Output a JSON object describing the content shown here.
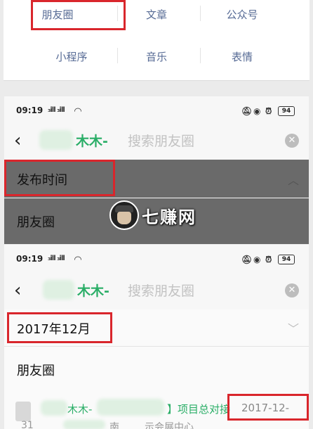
{
  "categories": {
    "row1": [
      "朋友圈",
      "文章",
      "公众号"
    ],
    "row2": [
      "小程序",
      "音乐",
      "表情"
    ]
  },
  "watermark": "七赚网",
  "screens": [
    {
      "time": "09:19",
      "signal": "₃ill ₃ill",
      "battery": "94",
      "contact": "木木-",
      "search_placeholder": "搜索朋友圈",
      "filter_label": "发布时间",
      "option_label": "朋友圈"
    },
    {
      "time": "09:19",
      "signal": "₃ill ₃ill",
      "battery": "94",
      "contact": "木木-",
      "search_placeholder": "搜索朋友圈",
      "filter_value": "2017年12月",
      "section_label": "朋友圈",
      "result": {
        "name": "木木-",
        "title": "】项目总对接",
        "date": "2017-12-",
        "date_cont": "31",
        "location_fragment": "南",
        "location_tail": "示会展中心"
      }
    }
  ],
  "colors": {
    "accent": "#2aae67",
    "highlight": "#d9262c",
    "link": "#576b95"
  }
}
